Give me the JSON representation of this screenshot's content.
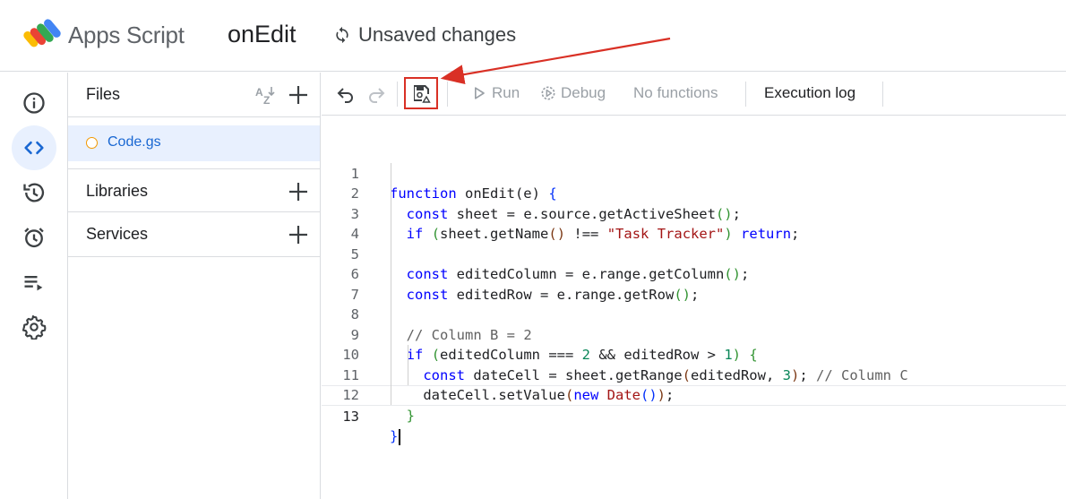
{
  "header": {
    "app_name": "Apps Script",
    "project_name": "onEdit",
    "save_status": "Unsaved changes"
  },
  "rail": {
    "items": [
      {
        "icon": "info-icon",
        "active": false
      },
      {
        "icon": "code-icon",
        "active": true
      },
      {
        "icon": "history-icon",
        "active": false
      },
      {
        "icon": "alarm-icon",
        "active": false
      },
      {
        "icon": "playlist-play-icon",
        "active": false
      },
      {
        "icon": "gear-icon",
        "active": false
      }
    ]
  },
  "files_panel": {
    "files_title": "Files",
    "file_name": "Code.gs",
    "libraries_title": "Libraries",
    "services_title": "Services"
  },
  "toolbar": {
    "run_label": "Run",
    "debug_label": "Debug",
    "function_select": "No functions",
    "execution_log_label": "Execution log"
  },
  "editor": {
    "line_numbers": [
      "1",
      "2",
      "3",
      "4",
      "5",
      "6",
      "7",
      "8",
      "9",
      "10",
      "11",
      "12",
      "13"
    ],
    "current_line": 13,
    "lines": [
      "function onEdit(e) {",
      "  const sheet = e.source.getActiveSheet();",
      "  if (sheet.getName() !== \"Task Tracker\") return;",
      "",
      "  const editedColumn = e.range.getColumn();",
      "  const editedRow = e.range.getRow();",
      "",
      "  // Column B = 2",
      "  if (editedColumn === 2 && editedRow > 1) {",
      "    const dateCell = sheet.getRange(editedRow, 3); // Column C",
      "    dateCell.setValue(new Date());",
      "  }",
      "}"
    ]
  },
  "colors": {
    "accent_blue": "#1967d2",
    "active_bg": "#e8f0fe",
    "annotation_red": "#d93025",
    "file_dot": "#f29900"
  }
}
